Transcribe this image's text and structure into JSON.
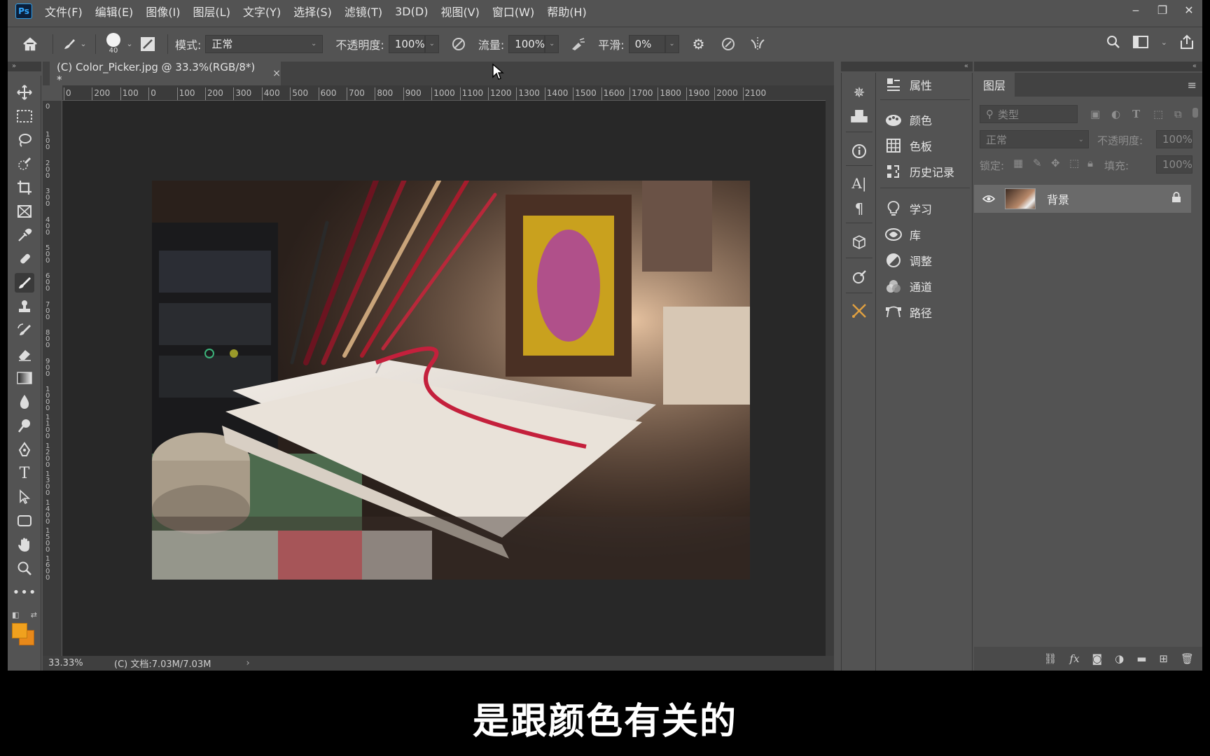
{
  "app": {
    "logo": "Ps"
  },
  "menu": [
    "文件(F)",
    "编辑(E)",
    "图像(I)",
    "图层(L)",
    "文字(Y)",
    "选择(S)",
    "滤镜(T)",
    "3D(D)",
    "视图(V)",
    "窗口(W)",
    "帮助(H)"
  ],
  "window_controls": {
    "minimize": "‒",
    "restore": "❐",
    "close": "✕"
  },
  "options": {
    "brush_size": "40",
    "mode_label": "模式:",
    "mode_value": "正常",
    "opacity_label": "不透明度:",
    "opacity_value": "100%",
    "flow_label": "流量:",
    "flow_value": "100%",
    "smoothing_label": "平滑:",
    "smoothing_value": "0%"
  },
  "document": {
    "tab_title": "(C) Color_Picker.jpg @ 33.3%(RGB/8*) *",
    "tab_close": "×",
    "zoom": "33.33%",
    "doc_info": "(C) 文档:7.03M/7.03M"
  },
  "ruler": {
    "h_labels": [
      "0",
      "200",
      "100",
      "0",
      "100",
      "200",
      "300",
      "400",
      "500",
      "600",
      "700",
      "800",
      "900",
      "1000",
      "1100",
      "1200",
      "1300",
      "1400",
      "1500",
      "1600",
      "1700",
      "1800",
      "1900",
      "2000",
      "2100"
    ],
    "v_labels": [
      "0",
      "1 0 0",
      "2 0 0",
      "3 0 0",
      "4 0 0",
      "5 0 0",
      "6 0 0",
      "7 0 0",
      "8 0 0",
      "9 0 0",
      "1 0 0 0",
      "1 1 0 0",
      "1 2 0 0",
      "1 3 0 0",
      "1 4 0 0",
      "1 5 0 0",
      "1 6 0 0"
    ]
  },
  "panels": [
    {
      "label": "属性",
      "icon": "properties-icon"
    },
    {
      "label": "颜色",
      "icon": "color-palette-icon"
    },
    {
      "label": "色板",
      "icon": "swatches-grid-icon"
    },
    {
      "label": "历史记录",
      "icon": "history-icon"
    },
    {
      "label": "学习",
      "icon": "lightbulb-icon"
    },
    {
      "label": "库",
      "icon": "libraries-icon"
    },
    {
      "label": "调整",
      "icon": "adjustments-icon"
    },
    {
      "label": "通道",
      "icon": "channels-icon"
    },
    {
      "label": "路径",
      "icon": "paths-icon"
    }
  ],
  "layers": {
    "tab": "图层",
    "filter_placeholder": "类型",
    "blend_mode": "正常",
    "opacity_label": "不透明度:",
    "opacity_value": "100%",
    "lock_label": "锁定:",
    "fill_label": "填充:",
    "fill_value": "100%",
    "items": [
      {
        "name": "背景",
        "visible": true,
        "locked": true
      }
    ]
  },
  "colors": {
    "foreground": "#f0a11e",
    "background": "#e8891a",
    "ui_bg": "#535353",
    "canvas_bg": "#282828"
  },
  "subtitle": "是跟颜色有关的"
}
